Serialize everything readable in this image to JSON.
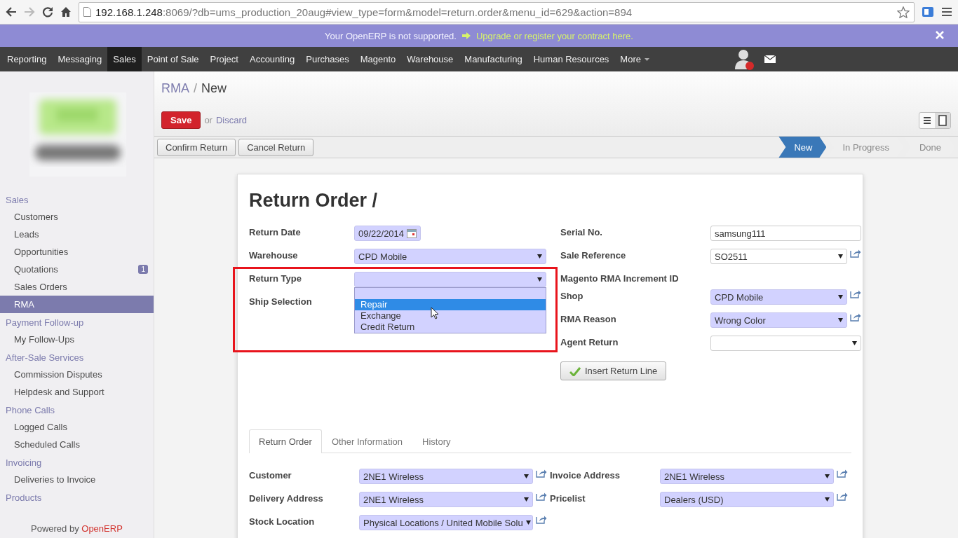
{
  "browser": {
    "host": "192.168.1.248",
    "path": ":8069/?db=ums_production_20aug#view_type=form&model=return.order&menu_id=629&action=894"
  },
  "banner": {
    "message": "Your OpenERP is not supported.",
    "link": "Upgrade or register your contract here."
  },
  "menu": [
    {
      "label": "Reporting",
      "selected": false
    },
    {
      "label": "Messaging",
      "selected": false
    },
    {
      "label": "Sales",
      "selected": true
    },
    {
      "label": "Point of Sale",
      "selected": false
    },
    {
      "label": "Project",
      "selected": false
    },
    {
      "label": "Accounting",
      "selected": false
    },
    {
      "label": "Purchases",
      "selected": false
    },
    {
      "label": "Magento",
      "selected": false
    },
    {
      "label": "Warehouse",
      "selected": false
    },
    {
      "label": "Manufacturing",
      "selected": false
    },
    {
      "label": "Human Resources",
      "selected": false
    },
    {
      "label": "More",
      "selected": false,
      "dropdown": true
    }
  ],
  "sidebar": {
    "sections": [
      {
        "title": "Sales",
        "items": [
          {
            "label": "Customers",
            "selected": false
          },
          {
            "label": "Leads",
            "selected": false
          },
          {
            "label": "Opportunities",
            "selected": false
          },
          {
            "label": "Quotations",
            "selected": false,
            "badge": "1"
          },
          {
            "label": "Sales Orders",
            "selected": false
          },
          {
            "label": "RMA",
            "selected": true
          }
        ]
      },
      {
        "title": "Payment Follow-up",
        "items": [
          {
            "label": "My Follow-Ups",
            "selected": false
          }
        ]
      },
      {
        "title": "After-Sale Services",
        "items": [
          {
            "label": "Commission Disputes",
            "selected": false
          },
          {
            "label": "Helpdesk and Support",
            "selected": false
          }
        ]
      },
      {
        "title": "Phone Calls",
        "items": [
          {
            "label": "Logged Calls",
            "selected": false
          },
          {
            "label": "Scheduled Calls",
            "selected": false
          }
        ]
      },
      {
        "title": "Invoicing",
        "items": [
          {
            "label": "Deliveries to Invoice",
            "selected": false
          }
        ]
      },
      {
        "title": "Products"
      }
    ],
    "powered_by": "Powered by",
    "brand": "OpenERP"
  },
  "breadcrumb": {
    "parent": "RMA",
    "separator": "/",
    "current": "New"
  },
  "actions": {
    "save": "Save",
    "or": "or",
    "discard": "Discard"
  },
  "workflow_buttons": [
    "Confirm Return",
    "Cancel Return"
  ],
  "stages": [
    {
      "label": "New",
      "selected": true
    },
    {
      "label": "In Progress",
      "selected": false
    },
    {
      "label": "Done",
      "selected": false
    }
  ],
  "form": {
    "title": "Return Order /",
    "left_fields": [
      {
        "label": "Return Date",
        "kind": "date",
        "value": "09/22/2014",
        "required": true
      },
      {
        "label": "Warehouse",
        "kind": "select",
        "value": "CPD Mobile",
        "required": true
      },
      {
        "label": "Return Type",
        "kind": "select",
        "required": true,
        "open": true,
        "highlighted": true,
        "blank_option": true,
        "options": [
          {
            "label": "Repair",
            "selected": true
          },
          {
            "label": "Exchange",
            "selected": false
          },
          {
            "label": "Credit Return",
            "selected": false
          }
        ]
      },
      {
        "label": "Ship Selection",
        "kind": "none",
        "highlighted": true
      }
    ],
    "right_fields": [
      {
        "label": "Serial No.",
        "kind": "text",
        "value": "samsung111",
        "required": false
      },
      {
        "label": "Sale Reference",
        "kind": "select",
        "value": "SO2511",
        "required": false,
        "link": true
      },
      {
        "label": "Magento RMA Increment ID",
        "kind": "none"
      },
      {
        "label": "Shop",
        "kind": "select",
        "value": "CPD Mobile",
        "required": true,
        "link": true
      },
      {
        "label": "RMA Reason",
        "kind": "select",
        "value": "Wrong Color",
        "required": true,
        "link": true
      },
      {
        "label": "Agent Return",
        "kind": "select",
        "required": false
      }
    ],
    "insert_button": "Insert Return Line",
    "tabs": [
      {
        "label": "Return Order",
        "selected": true
      },
      {
        "label": "Other Information",
        "selected": false
      },
      {
        "label": "History",
        "selected": false
      }
    ],
    "tab_left_fields": [
      {
        "label": "Customer",
        "kind": "select",
        "value": "2NE1 Wireless",
        "required": true,
        "link": true
      },
      {
        "label": "Delivery Address",
        "kind": "select",
        "value": "2NE1 Wireless",
        "required": true,
        "link": true
      },
      {
        "label": "Stock Location",
        "kind": "select",
        "value": "Physical Locations / United Mobile Solu",
        "required": true,
        "link": true
      }
    ],
    "tab_right_fields": [
      {
        "label": "Invoice Address",
        "kind": "select",
        "value": "2NE1 Wireless",
        "required": true,
        "link": true
      },
      {
        "label": "Pricelist",
        "kind": "select",
        "value": "Dealers (USD)",
        "required": true,
        "link": true
      }
    ]
  }
}
